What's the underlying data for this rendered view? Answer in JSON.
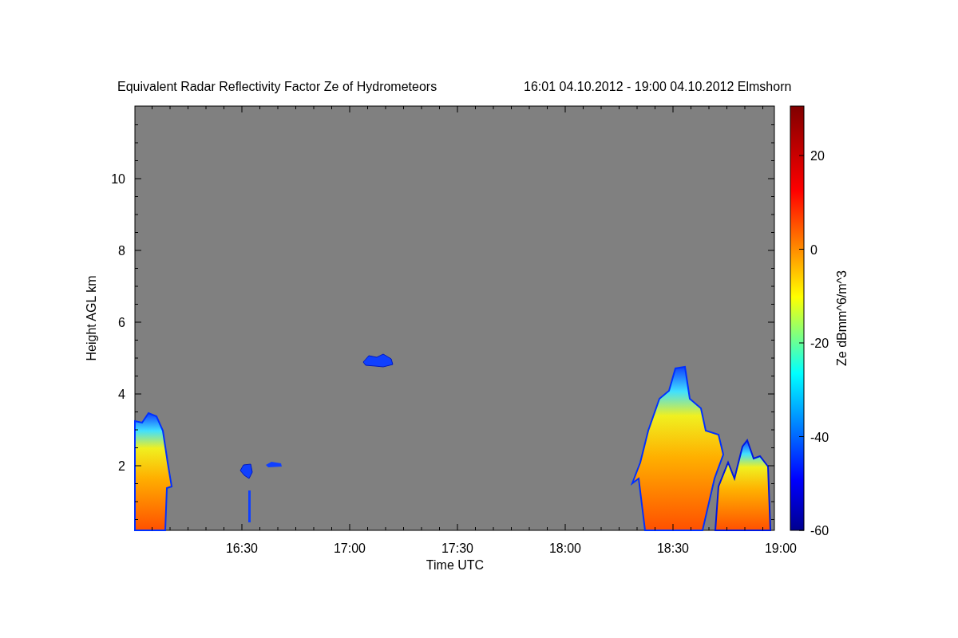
{
  "title": "Equivalent Radar Reflectivity Factor Ze of Hydrometeors",
  "period": "16:01 04.10.2012 - 19:00 04.10.2012 Elmshorn",
  "y_axis": {
    "label": "Height AGL km",
    "ticks": [
      "10",
      "8",
      "6",
      "4",
      "2"
    ]
  },
  "x_axis": {
    "label": "Time UTC",
    "ticks": [
      "16:30",
      "17:00",
      "17:30",
      "18:00",
      "18:30",
      "19:00"
    ]
  },
  "colorbar": {
    "label": "Ze dBmm^6/m^3",
    "ticks": [
      "20",
      "0",
      "-20",
      "-40",
      "-60"
    ]
  }
}
